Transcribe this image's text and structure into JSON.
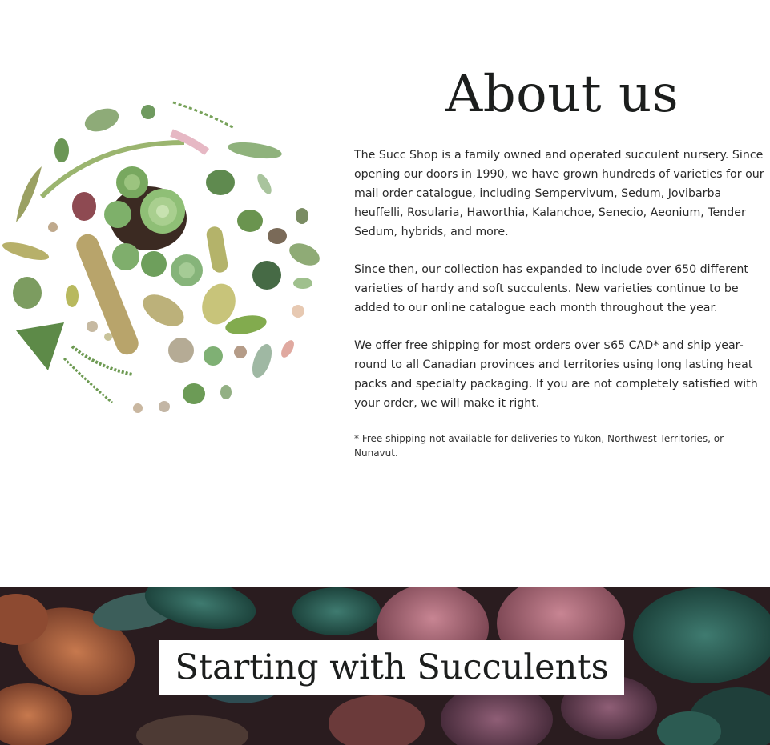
{
  "about": {
    "title": "About us",
    "paragraphs": [
      "The Succ Shop is a family owned and operated succulent nursery. Since opening our doors in 1990, we have grown hundreds of varieties for our mail order catalogue, including Sempervivum, Sedum, Jovibarba heuffelli, Rosularia, Haworthia, Kalanchoe, Senecio, Aeonium, Tender Sedum, hybrids, and more.",
      "Since then, our collection has expanded to include over 650 different varieties of hardy and soft succulents. New varieties continue to be added to our online catalogue each month throughout the year.",
      "We offer free shipping for most orders over $65 CAD* and ship year-round to all Canadian provinces and territories using long lasting heat packs and specialty packaging. If you are not completely satisfied with your order, we will make it right."
    ],
    "footnote": "* Free shipping not available for deliveries to Yukon, Northwest Territories, or Nunavut."
  },
  "banner": {
    "title": "Starting with Succulents"
  },
  "colors": {
    "text": "#2b2b2b",
    "heading": "#1c1e1d",
    "background": "#ffffff",
    "banner_dark": "#2b1d1f"
  }
}
